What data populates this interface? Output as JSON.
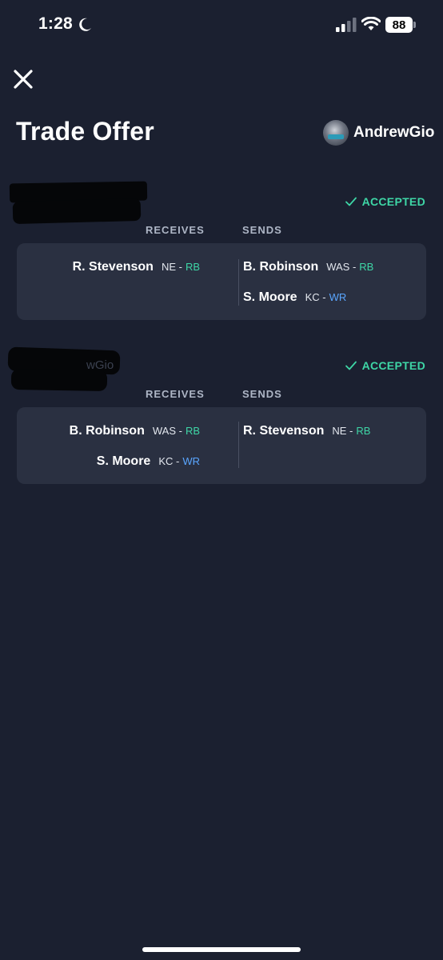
{
  "status_bar": {
    "time": "1:28",
    "battery": "88"
  },
  "header": {
    "title": "Trade Offer",
    "username": "AndrewGio"
  },
  "columns": {
    "receives": "RECEIVES",
    "sends": "SENDS"
  },
  "trades": [
    {
      "status": "ACCEPTED",
      "redacted_fragment": "",
      "receives": [
        {
          "name": "R. Stevenson",
          "team": "NE -",
          "pos": "RB"
        }
      ],
      "sends": [
        {
          "name": "B. Robinson",
          "team": "WAS -",
          "pos": "RB"
        },
        {
          "name": "S. Moore",
          "team": "KC -",
          "pos": "WR"
        }
      ]
    },
    {
      "status": "ACCEPTED",
      "redacted_fragment": "wGio",
      "receives": [
        {
          "name": "B. Robinson",
          "team": "WAS -",
          "pos": "RB"
        },
        {
          "name": "S. Moore",
          "team": "KC -",
          "pos": "WR"
        }
      ],
      "sends": [
        {
          "name": "R. Stevenson",
          "team": "NE -",
          "pos": "RB"
        }
      ]
    }
  ],
  "colors": {
    "background": "#1b2030",
    "card": "#2a3041",
    "accepted": "#3ed6a6",
    "rb": "#3ed6a6",
    "wr": "#5aa6ff"
  },
  "icons": [
    "moon-icon",
    "signal-icon",
    "wifi-icon",
    "battery-icon",
    "close-icon",
    "checkmark-icon"
  ]
}
